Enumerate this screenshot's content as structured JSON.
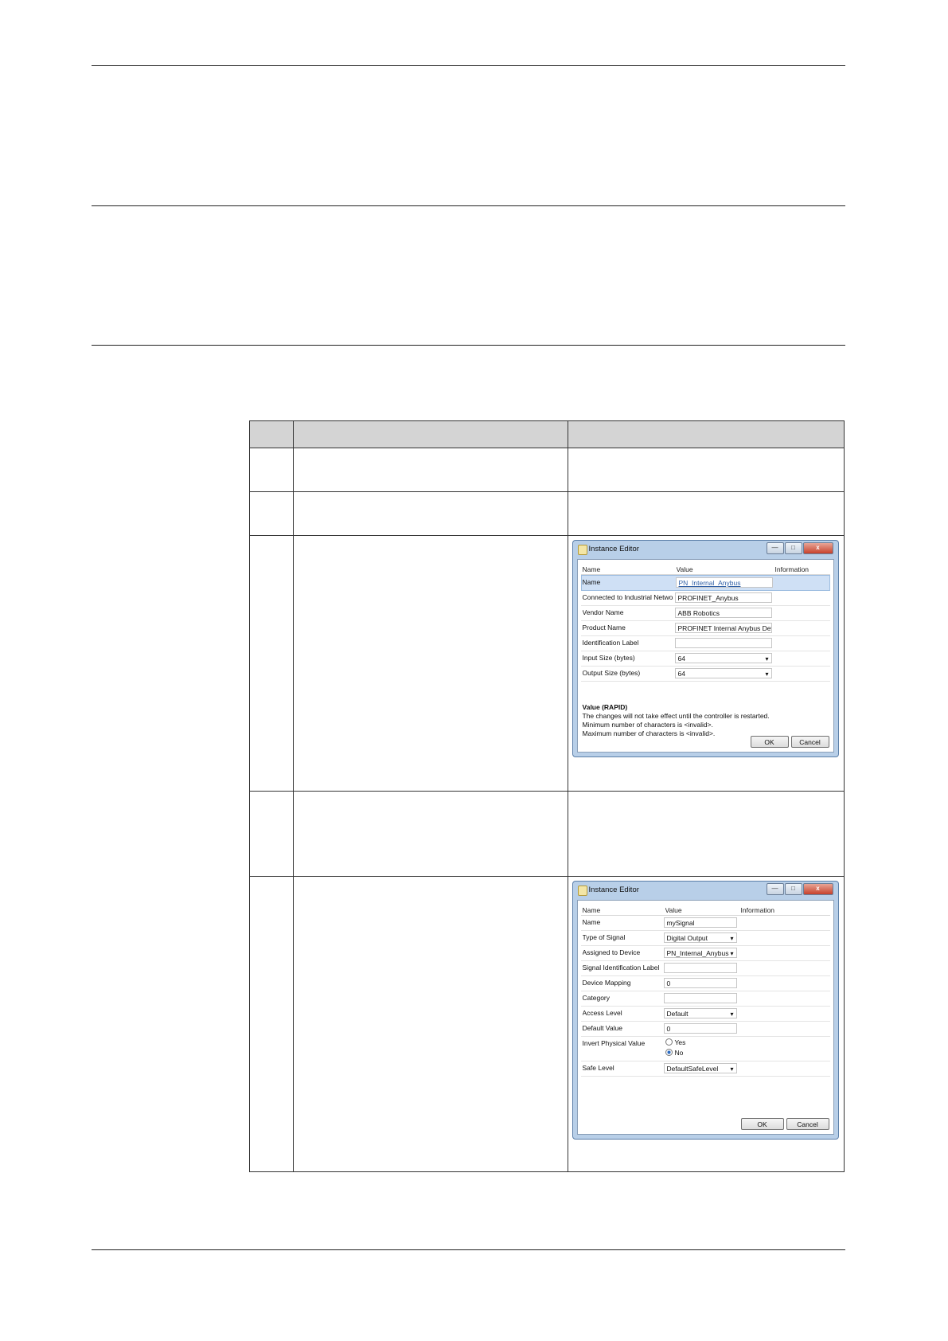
{
  "dialog1": {
    "title": "Instance Editor",
    "window_buttons": [
      "—",
      "□",
      "x"
    ],
    "columns": [
      "Name",
      "Value",
      "Information"
    ],
    "rows": [
      {
        "name": "Name",
        "value": "PN_Internal_Anybus"
      },
      {
        "name": "Connected to Industrial Network",
        "value": "PROFINET_Anybus"
      },
      {
        "name": "Vendor Name",
        "value": "ABB Robotics"
      },
      {
        "name": "Product Name",
        "value": "PROFINET Internal Anybus Device"
      },
      {
        "name": "Identification Label",
        "value": ""
      },
      {
        "name": "Input Size (bytes)",
        "value": "64"
      },
      {
        "name": "Output Size (bytes)",
        "value": "64"
      }
    ],
    "info_title": "Value (RAPID)",
    "info_lines": [
      "The changes will not take effect until the controller is restarted.",
      "Minimum number of characters is <invalid>.",
      "Maximum number of characters is <invalid>."
    ],
    "ok_label": "OK",
    "cancel_label": "Cancel"
  },
  "dialog2": {
    "title": "Instance Editor",
    "window_buttons": [
      "—",
      "□",
      "x"
    ],
    "columns": [
      "Name",
      "Value",
      "Information"
    ],
    "rows": [
      {
        "name": "Name",
        "value": "mySignal"
      },
      {
        "name": "Type of Signal",
        "value": "Digital Output"
      },
      {
        "name": "Assigned to Device",
        "value": "PN_Internal_Anybus"
      },
      {
        "name": "Signal Identification Label",
        "value": ""
      },
      {
        "name": "Device Mapping",
        "value": "0"
      },
      {
        "name": "Category",
        "value": ""
      },
      {
        "name": "Access Level",
        "value": "Default"
      },
      {
        "name": "Default Value",
        "value": "0"
      },
      {
        "name": "Invert Physical Value",
        "value": ""
      },
      {
        "name": "Safe Level",
        "value": "DefaultSafeLevel"
      }
    ],
    "radio_yes": "Yes",
    "radio_no": "No",
    "ok_label": "OK",
    "cancel_label": "Cancel"
  }
}
